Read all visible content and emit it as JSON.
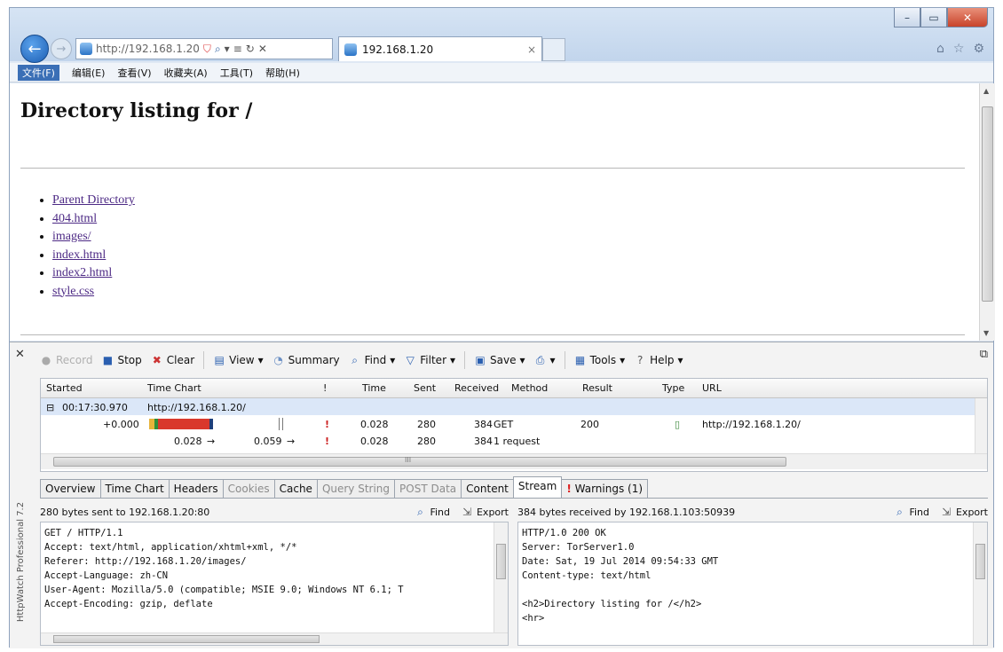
{
  "browser": {
    "address_url": "http://192.168.1.20",
    "address_host": "192.168.1.20",
    "tab_title": "192.168.1.20",
    "tab_close": "×",
    "menu": [
      "文件(F)",
      "编辑(E)",
      "查看(V)",
      "收藏夹(A)",
      "工具(T)",
      "帮助(H)"
    ]
  },
  "page": {
    "heading": "Directory listing for /",
    "items": [
      "Parent Directory",
      "404.html",
      "images/",
      "index.html",
      "index2.html",
      "style.css"
    ]
  },
  "httpwatch": {
    "side_label": "HttpWatch Professional 7.2",
    "toolbar": {
      "record": "Record",
      "stop": "Stop",
      "clear": "Clear",
      "view": "View",
      "summary": "Summary",
      "find": "Find",
      "filter": "Filter",
      "save": "Save",
      "tools": "Tools",
      "help": "Help"
    },
    "columns": [
      "Started",
      "Time Chart",
      "!",
      "Time",
      "Sent",
      "Received",
      "Method",
      "Result",
      "Type",
      "URL"
    ],
    "group": {
      "started": "00:17:30.970",
      "url": "http://192.168.1.20/"
    },
    "row": {
      "started": "+0.000",
      "bang": "!",
      "time": "0.028",
      "sent": "280",
      "received": "384",
      "method": "GET",
      "result": "200",
      "url": "http://192.168.1.20/"
    },
    "summary": {
      "t1": "0.028",
      "t2": "0.059",
      "bang": "!",
      "time": "0.028",
      "sent": "280",
      "received": "384",
      "method": "1 request"
    },
    "hscroll_marker": "III",
    "tabs": [
      "Overview",
      "Time Chart",
      "Headers",
      "Cookies",
      "Cache",
      "Query String",
      "POST Data",
      "Content",
      "Stream",
      "Warnings (1)"
    ],
    "left_pane": {
      "title": "280 bytes sent to 192.168.1.20:80",
      "find": "Find",
      "export": "Export",
      "text": "GET / HTTP/1.1\nAccept: text/html, application/xhtml+xml, */*\nReferer: http://192.168.1.20/images/\nAccept-Language: zh-CN\nUser-Agent: Mozilla/5.0 (compatible; MSIE 9.0; Windows NT 6.1; T\nAccept-Encoding: gzip, deflate"
    },
    "right_pane": {
      "title": "384 bytes received by 192.168.1.103:50939",
      "find": "Find",
      "export": "Export",
      "text": "HTTP/1.0 200 OK\nServer: TorServer1.0\nDate: Sat, 19 Jul 2014 09:54:33 GMT\nContent-type: text/html\n\n<h2>Directory listing for /</h2>\n<hr>"
    }
  },
  "colors": {
    "link": "#4d2a85",
    "group_row": "#dbe7f8",
    "bar_red": "#d9382c",
    "bar_green": "#2f8f3a",
    "bar_yellow": "#e7b43a"
  }
}
